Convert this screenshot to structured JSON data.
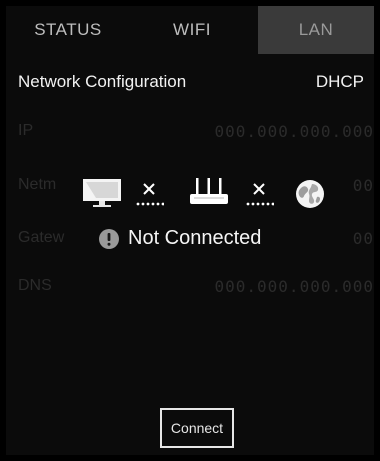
{
  "tabs": [
    {
      "label": "STATUS"
    },
    {
      "label": "WIFI"
    },
    {
      "label": "LAN"
    }
  ],
  "header": {
    "title": "Network Configuration",
    "mode": "DHCP"
  },
  "fields": [
    {
      "label": "IP",
      "value": "000.000.000.000"
    },
    {
      "label": "Netm",
      "value": "00"
    },
    {
      "label": "Gatew",
      "value": "00"
    },
    {
      "label": "DNS",
      "value": "000.000.000.000"
    }
  ],
  "connection": {
    "status_text": "Not Connected",
    "icons": [
      "monitor-icon",
      "disconnected-icon",
      "router-icon",
      "disconnected-icon",
      "globe-icon",
      "info-icon"
    ]
  },
  "actions": {
    "connect_label": "Connect"
  },
  "colors": {
    "background": "#0b0b0b",
    "active_tab": "#3a3a3a",
    "text": "#f2f2f2",
    "dim_text": "#2b2b2b"
  }
}
